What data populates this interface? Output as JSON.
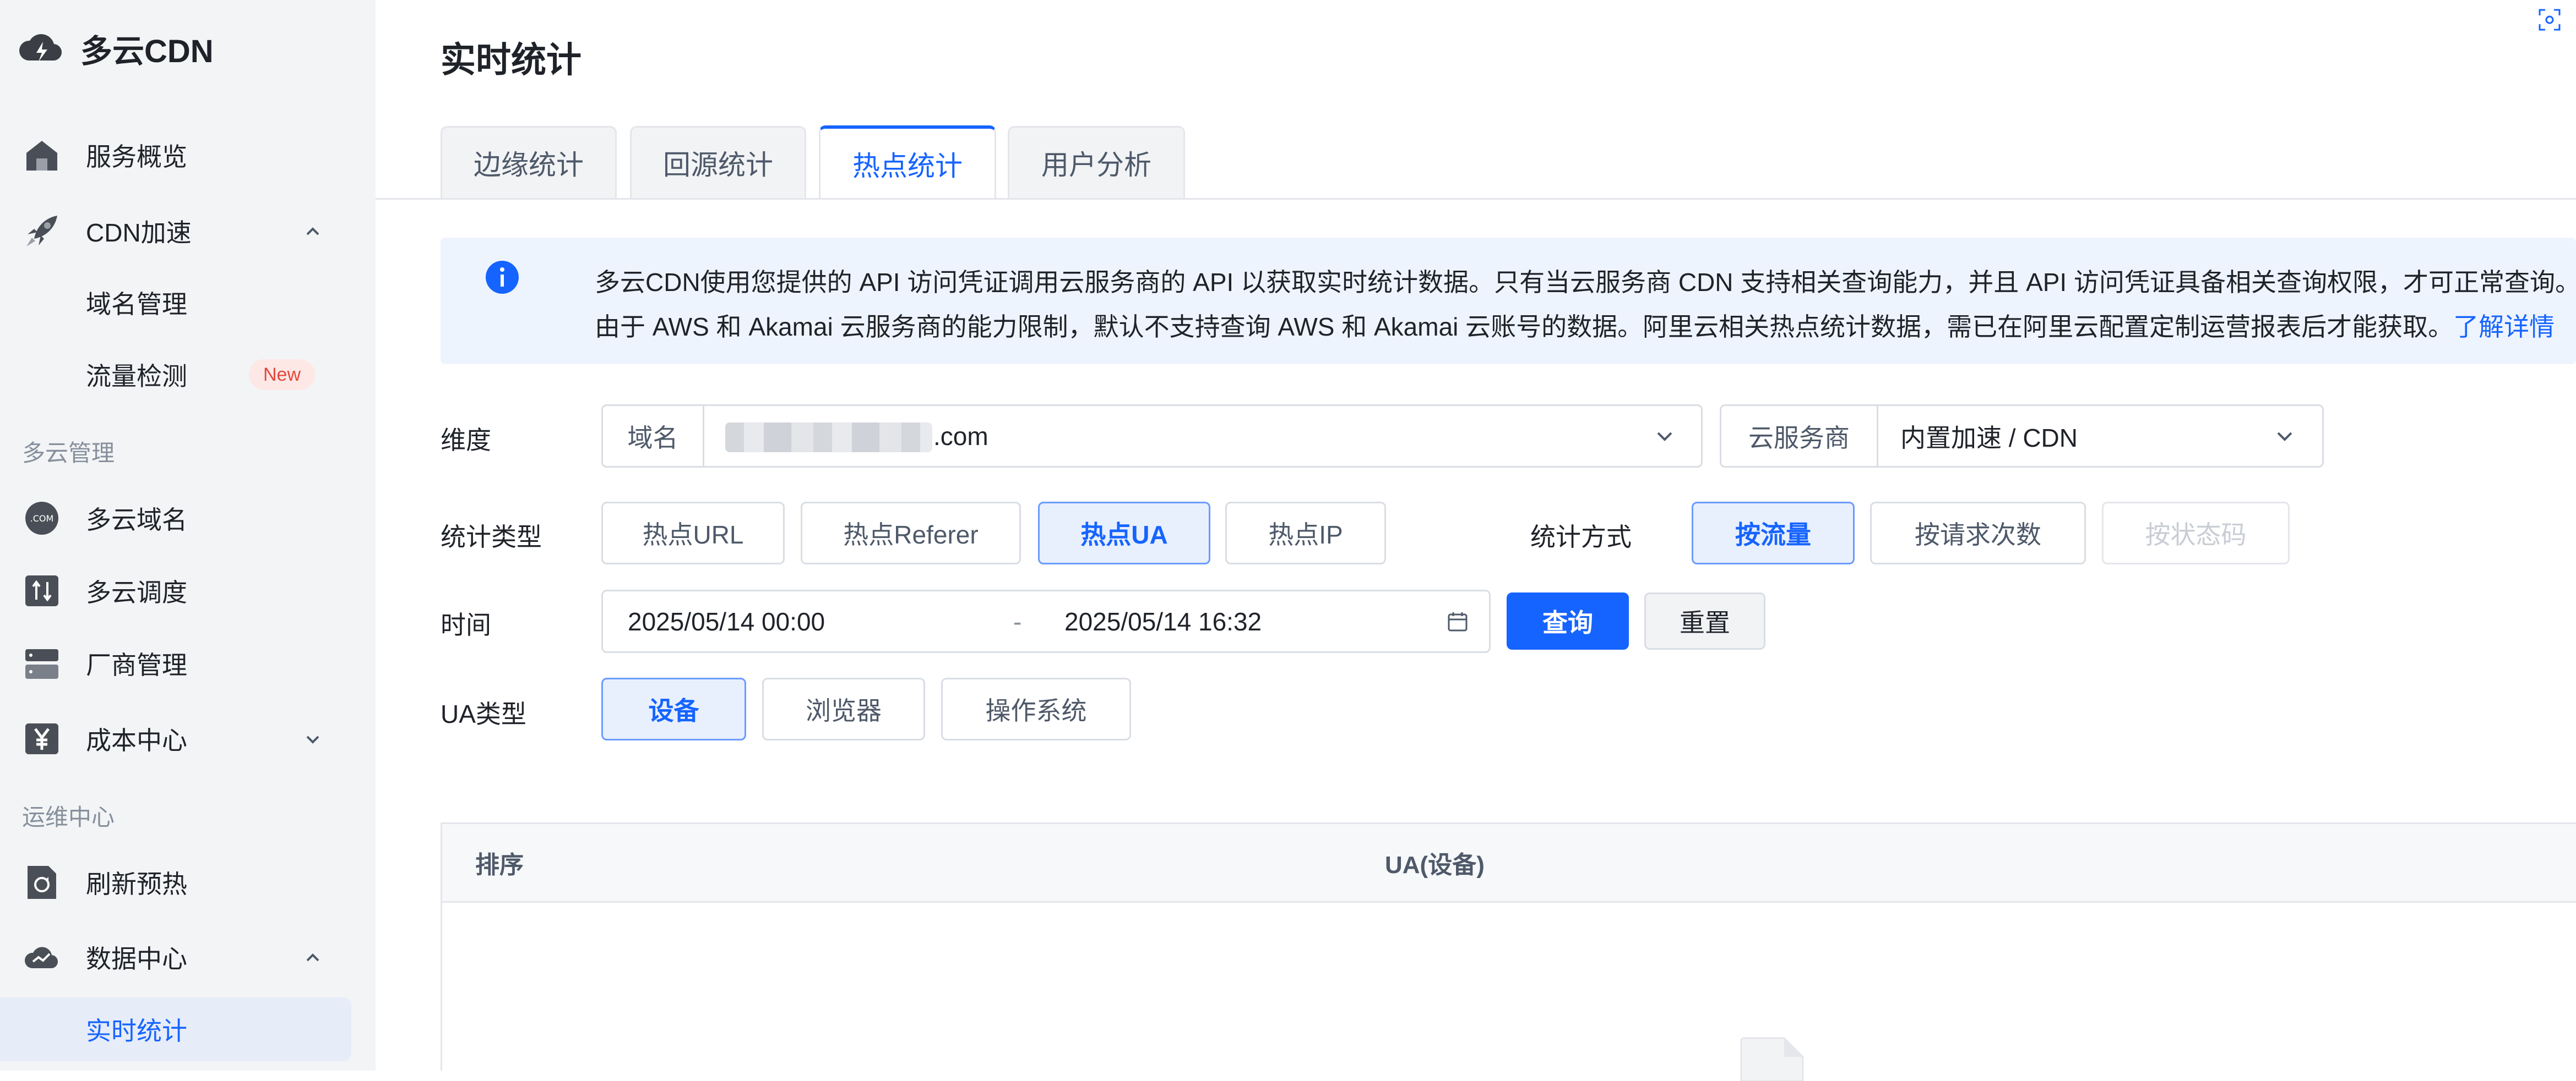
{
  "app": {
    "name": "多云CDN"
  },
  "sidebar": {
    "items": [
      {
        "label": "服务概览",
        "icon": "home-icon"
      },
      {
        "label": "CDN加速",
        "icon": "rocket-icon"
      },
      {
        "label": "域名管理"
      },
      {
        "label": "流量检测",
        "badge": "New"
      },
      {
        "label": "多云域名",
        "icon": "com-domain-icon"
      },
      {
        "label": "多云调度",
        "icon": "schedule-icon"
      },
      {
        "label": "厂商管理",
        "icon": "server-icon"
      },
      {
        "label": "成本中心",
        "icon": "yen-icon"
      },
      {
        "label": "刷新预热",
        "icon": "refresh-file-icon"
      },
      {
        "label": "数据中心",
        "icon": "cloud-chart-icon"
      },
      {
        "label": "实时统计",
        "active": true
      }
    ],
    "groups": [
      "多云管理",
      "运维中心"
    ]
  },
  "page": {
    "title": "实时统计"
  },
  "tabs": [
    {
      "label": "边缘统计"
    },
    {
      "label": "回源统计"
    },
    {
      "label": "热点统计",
      "active": true
    },
    {
      "label": "用户分析"
    }
  ],
  "notice": {
    "line1": "多云CDN使用您提供的 API 访问凭证调用云服务商的 API 以获取实时统计数据。只有当云服务商 CDN 支持相关查询能力，并且 API 访问凭证具备相关查询权限，才可正常查询。",
    "line2": "由于 AWS 和 Akamai 云服务商的能力限制，默认不支持查询 AWS 和 Akamai 云账号的数据。阿里云相关热点统计数据，需已在阿里云配置定制运营报表后才能获取。",
    "link": "了解详情"
  },
  "filters": {
    "dimension_label": "维度",
    "domain_addon": "域名",
    "domain_value": ".com",
    "provider_addon": "云服务商",
    "provider_value": "内置加速 / CDN",
    "stat_type_label": "统计类型",
    "stat_types": [
      "热点URL",
      "热点Referer",
      "热点UA",
      "热点IP"
    ],
    "stat_type_selected": "热点UA",
    "stat_method_label": "统计方式",
    "stat_methods": [
      "按流量",
      "按请求次数",
      "按状态码"
    ],
    "stat_method_selected": "按流量",
    "time_label": "时间",
    "time_start": "2025/05/14 00:00",
    "time_sep": "-",
    "time_end": "2025/05/14 16:32",
    "query_button": "查询",
    "reset_button": "重置",
    "ua_type_label": "UA类型",
    "ua_types": [
      "设备",
      "浏览器",
      "操作系统"
    ],
    "ua_type_selected": "设备"
  },
  "table": {
    "columns": [
      "排序",
      "UA(设备)"
    ]
  },
  "colors": {
    "accent": "#1664ff",
    "sidebar_bg": "#f3f4f6",
    "active_bg": "#e7ecf9",
    "badge": "#e4473a"
  }
}
